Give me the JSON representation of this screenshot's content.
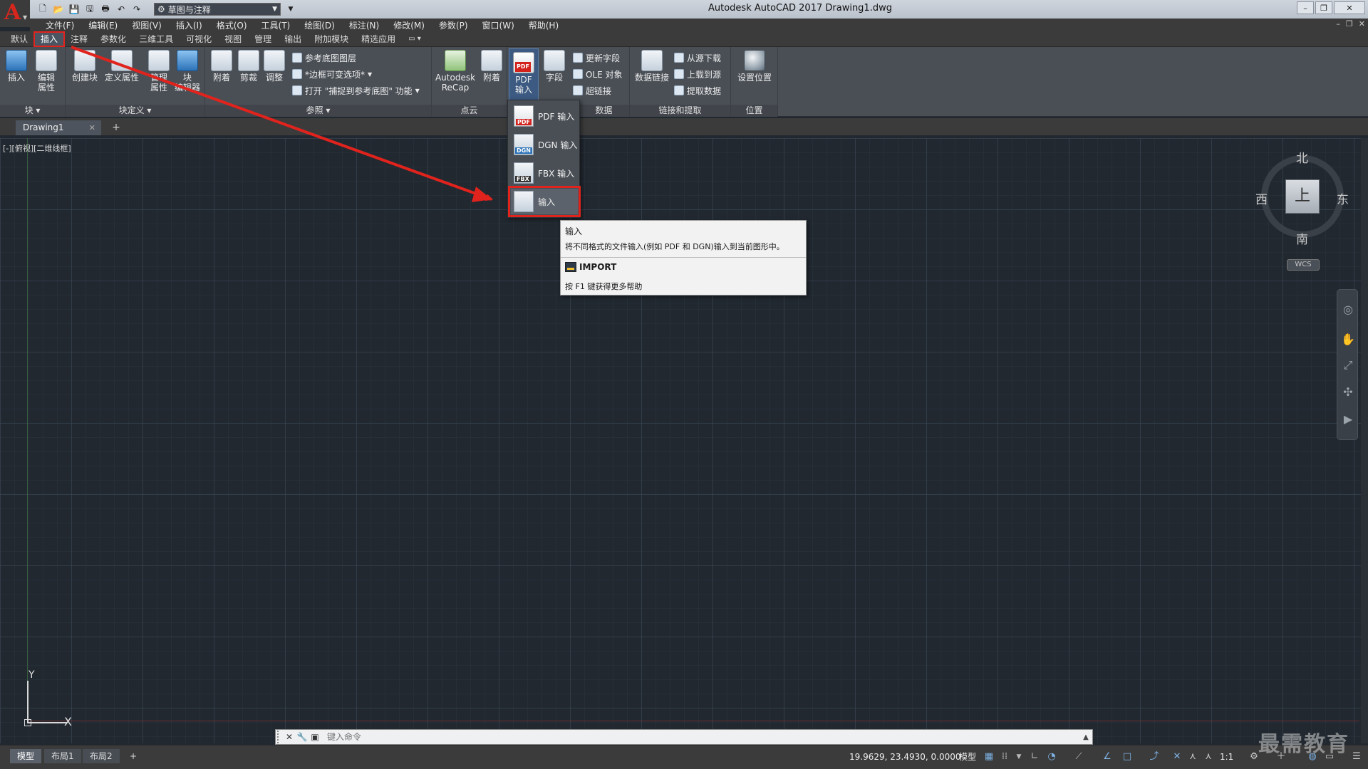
{
  "app": {
    "title": "Autodesk AutoCAD 2017    Drawing1.dwg",
    "workspace": "草图与注释"
  },
  "menu": [
    "文件(F)",
    "编辑(E)",
    "视图(V)",
    "插入(I)",
    "格式(O)",
    "工具(T)",
    "绘图(D)",
    "标注(N)",
    "修改(M)",
    "参数(P)",
    "窗口(W)",
    "帮助(H)"
  ],
  "ribbon_tabs": [
    "默认",
    "插入",
    "注释",
    "参数化",
    "三维工具",
    "可视化",
    "视图",
    "管理",
    "输出",
    "附加模块",
    "精选应用"
  ],
  "ribbon": {
    "block": {
      "insert": "插入",
      "edit_attr": "编辑\n属性",
      "title": "块 ▾"
    },
    "block_def": {
      "create": "创建块",
      "define_attr": "定义属性",
      "manage_attr": "管理\n属性",
      "block_editor": "块\n编辑器",
      "title": "块定义 ▾"
    },
    "reference": {
      "attach": "附着",
      "clip": "剪裁",
      "adjust": "调整",
      "underlay_layers": "参考底图图层",
      "frame_vary": "*边框可变选项*",
      "snap_underlay": "打开 \"捕捉到参考底图\" 功能",
      "title": "参照 ▾"
    },
    "pointcloud": {
      "recap": "Autodesk\nReCap",
      "attach": "附着",
      "title": "点云"
    },
    "import": {
      "pdf_import": "PDF\n输入"
    },
    "data": {
      "field": "字段",
      "update_fields": "更新字段",
      "ole": "OLE 对象",
      "hyperlink": "超链接",
      "title": "数据"
    },
    "linking": {
      "data_link": "数据链接",
      "download": "从源下载",
      "upload": "上载到源",
      "extract": "提取数据",
      "title": "链接和提取"
    },
    "location": {
      "set_location": "设置位置",
      "title": "位置"
    }
  },
  "dropdown": [
    {
      "label": "PDF 输入",
      "tag": "PDF"
    },
    {
      "label": "DGN 输入",
      "tag": "DGN"
    },
    {
      "label": "FBX 输入",
      "tag": "FBX"
    },
    {
      "label": "输入",
      "tag": ""
    }
  ],
  "tooltip": {
    "title": "输入",
    "description": "将不同格式的文件输入(例如 PDF 和 DGN)输入到当前图形中。",
    "command": "IMPORT",
    "help": "按 F1 键获得更多帮助"
  },
  "doc_tab": "Drawing1",
  "view_label": "[-][俯视][二维线框]",
  "viewcube": {
    "north": "北",
    "south": "南",
    "east": "东",
    "west": "西",
    "face": "上",
    "wcs": "WCS"
  },
  "ucs": {
    "x": "X",
    "y": "Y"
  },
  "command": {
    "placeholder": "键入命令"
  },
  "status": {
    "layouts": [
      "模型",
      "布局1",
      "布局2"
    ],
    "coords": "19.9629, 23.4930, 0.0000",
    "model": "模型",
    "scale": "1:1"
  },
  "watermark": "最需教育",
  "colors": {
    "highlight": "#e1231d",
    "canvas": "#212830"
  }
}
